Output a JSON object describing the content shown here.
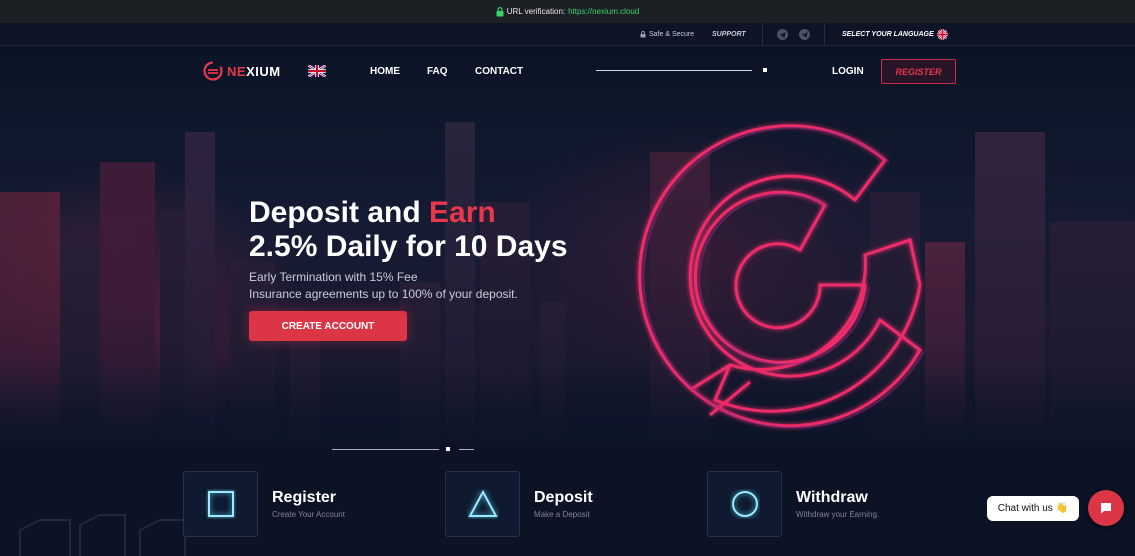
{
  "verification": {
    "label": "URL verification:",
    "url": "https://nexium.cloud",
    "icon": "lock-icon"
  },
  "top_strip": {
    "safe_label": "Safe & Secure",
    "support_label": "SUPPORT",
    "language_label": "SELECT YOUR LANGUAGE",
    "icons": [
      "lock-icon",
      "telegram-icon",
      "telegram-icon",
      "uk-flag-icon"
    ]
  },
  "nav": {
    "logo_prefix": "NE",
    "logo_suffix": "XIUM",
    "links": [
      "HOME",
      "FAQ",
      "CONTACT"
    ],
    "login": "LOGIN",
    "register": "REGISTER"
  },
  "hero": {
    "line1_a": "Deposit and ",
    "line1_b": "Earn",
    "line2": "2.5% Daily for 10 Days",
    "sub1": "Early Termination with 15% Fee",
    "sub2": "Insurance agreements up to 100% of your deposit.",
    "cta": "CREATE ACCOUNT"
  },
  "features": [
    {
      "title": "Register",
      "subtitle": "Create Your Account",
      "icon": "square-icon"
    },
    {
      "title": "Deposit",
      "subtitle": "Make a Deposit",
      "icon": "triangle-icon"
    },
    {
      "title": "Withdraw",
      "subtitle": "Withdraw your Earning.",
      "icon": "circle-icon"
    }
  ],
  "chat": {
    "label": "Chat with us",
    "wave": "👋"
  },
  "colors": {
    "accent": "#dc3545",
    "brand_red": "#e8374a",
    "background": "#0b1324"
  }
}
